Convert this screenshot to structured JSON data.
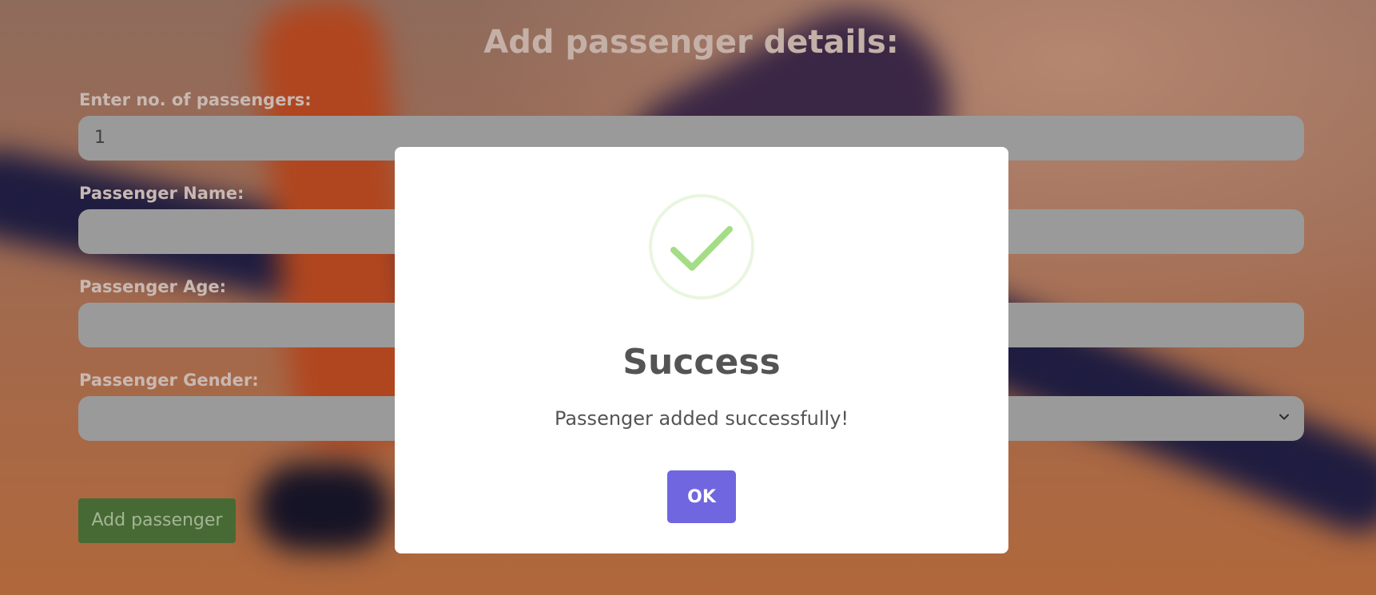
{
  "form": {
    "title": "Add passenger details:",
    "passenger_count": {
      "label": "Enter no. of passengers:",
      "value": "1"
    },
    "passenger_name": {
      "label": "Passenger Name:",
      "value": ""
    },
    "passenger_age": {
      "label": "Passenger Age:",
      "value": ""
    },
    "passenger_gender": {
      "label": "Passenger Gender:",
      "value": ""
    },
    "add_button_label": "Add passenger"
  },
  "modal": {
    "icon": "checkmark-icon",
    "title": "Success",
    "message": "Passenger added successfully!",
    "ok_label": "OK"
  },
  "colors": {
    "confirm_button": "#7066e0",
    "success_icon": "#a5dc86",
    "add_button": "#476a35"
  }
}
